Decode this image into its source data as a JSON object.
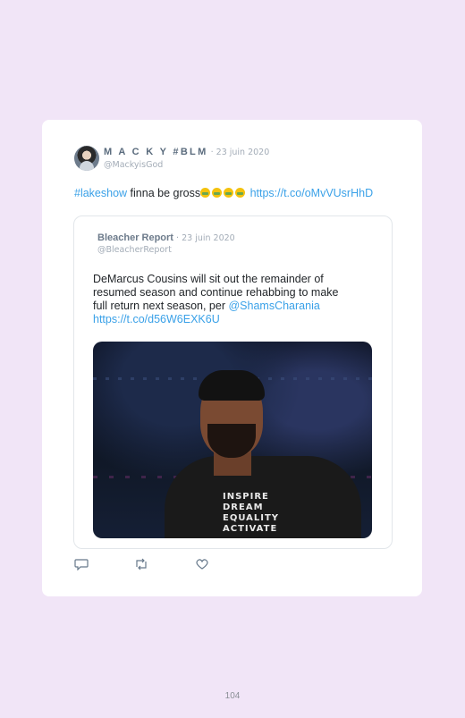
{
  "tweet": {
    "author_name": "M A C K Y #BLM",
    "date": "· 23 juin 2020",
    "handle": "@MackyisGod",
    "text_hashtag": "#lakeshow",
    "text_body": " finna be gross",
    "text_link": "https://t.co/oMvVUsrHhD"
  },
  "quote": {
    "author_name": "Bleacher Report",
    "date": "· 23 juin 2020",
    "handle": "@BleacherReport",
    "text_line1": "DeMarcus Cousins will sit out the remainder of",
    "text_line2": "resumed season and continue rehabbing to make",
    "text_line3": "full return next season, per ",
    "text_mention": "@ShamsCharania",
    "text_link": "https://t.co/d56W6EXK6U",
    "media_shirt_text": "INSPIRE DREAM EQUALITY ACTIVATE"
  },
  "actions": {
    "reply_icon": "reply-icon",
    "retweet_icon": "retweet-icon",
    "like_icon": "heart-icon"
  },
  "page_number": "104",
  "colors": {
    "background": "#f1e5f7",
    "link": "#3aa1e8"
  }
}
